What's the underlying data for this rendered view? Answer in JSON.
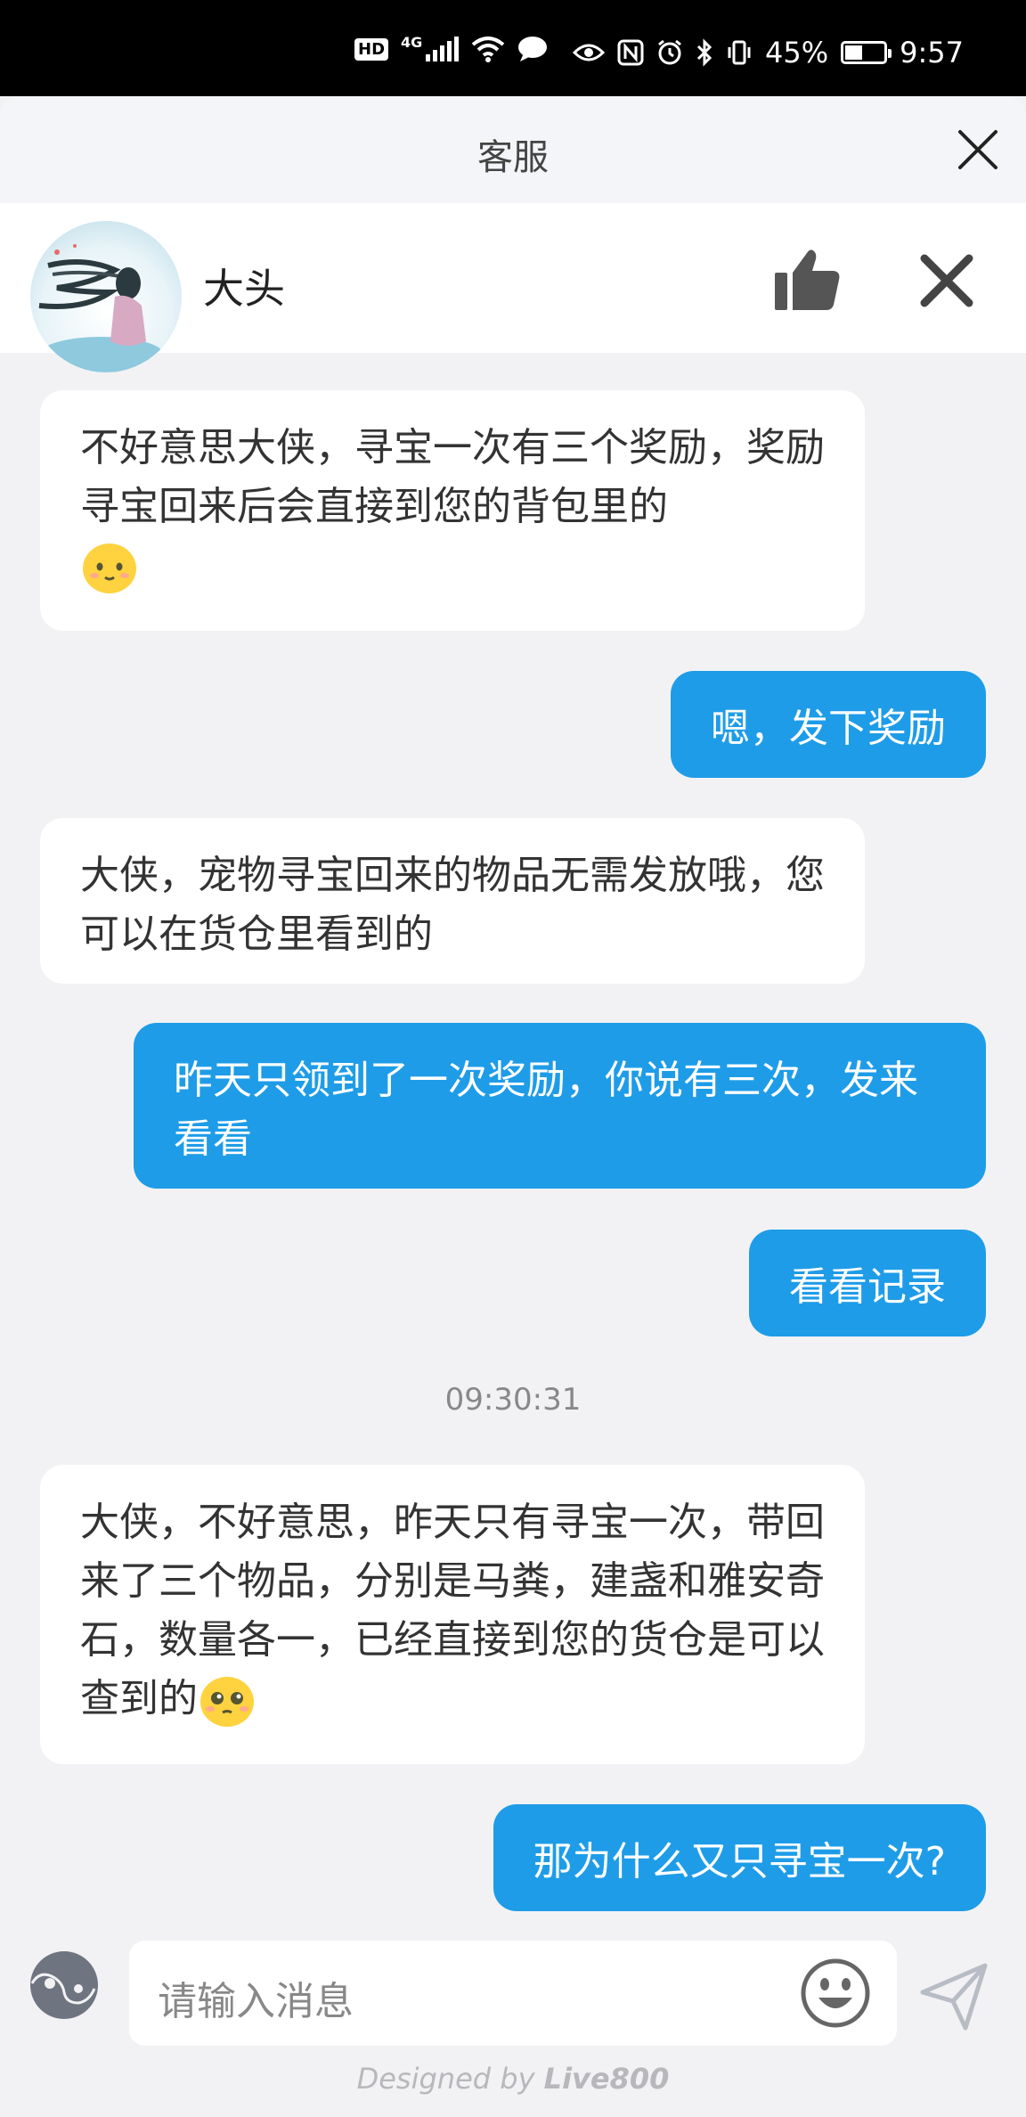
{
  "status_bar": {
    "network": "4G",
    "battery_level": 0.45,
    "battery_text": "45%",
    "time": "9:57"
  },
  "header": {
    "title": "客服"
  },
  "agent": {
    "name": "大头"
  },
  "messages": [
    {
      "from": "agent",
      "text": "不好意思大侠，寻宝一次有三个奖励，奖励寻宝回来后会直接到您的背包里的",
      "emoji": "smile-emoji"
    },
    {
      "from": "user",
      "text": "嗯，发下奖励"
    },
    {
      "from": "agent",
      "text": "大侠，宠物寻宝回来的物品无需发放哦，您可以在货仓里看到的"
    },
    {
      "from": "user",
      "text": "昨天只领到了一次奖励，你说有三次，发来看看"
    },
    {
      "from": "user",
      "text": "看看记录"
    },
    {
      "from": "agent",
      "text": "大侠，不好意思，昨天只有寻宝一次，带回来了三个物品，分别是马粪，建盏和雅安奇石，数量各一，已经直接到您的货仓是可以查到的",
      "emoji": "pleading-emoji"
    },
    {
      "from": "user",
      "text": "那为什么又只寻宝一次?"
    }
  ],
  "timestamp": "09:30:31",
  "input": {
    "placeholder": "请输入消息"
  },
  "footer": {
    "prefix": "Designed by ",
    "brand": "Live800"
  },
  "colors": {
    "user_bubble": "#1e9ce8",
    "agent_bubble": "#ffffff",
    "background": "#f2f2f4"
  }
}
